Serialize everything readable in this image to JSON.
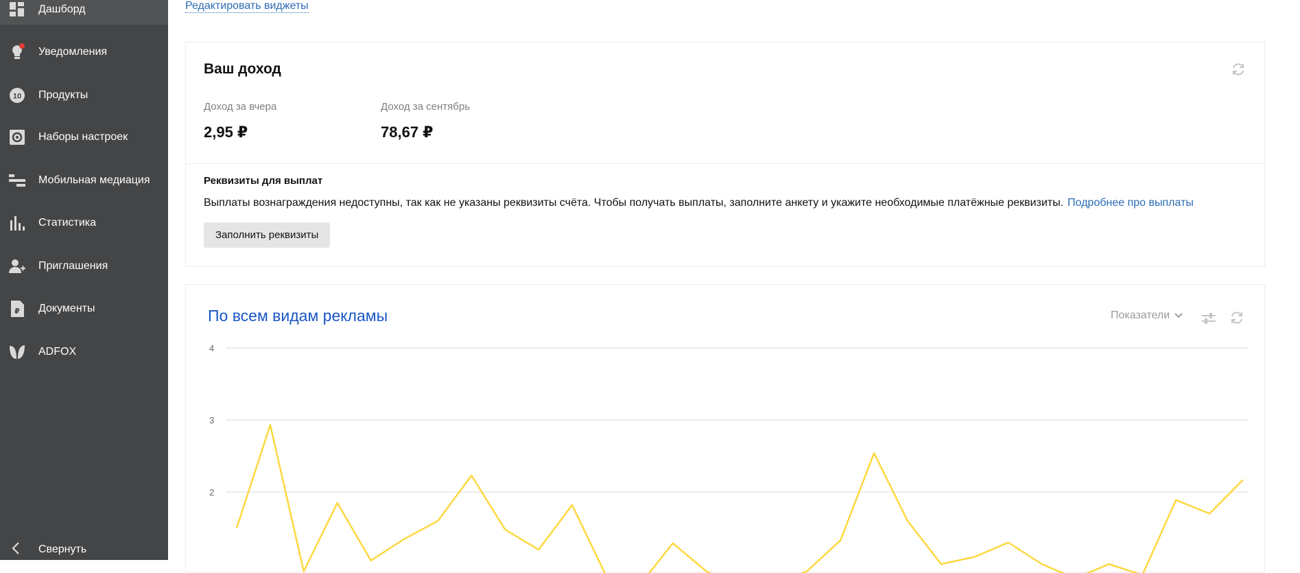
{
  "sidebar": {
    "items": [
      {
        "label": "Дашборд",
        "icon": "dashboard-icon"
      },
      {
        "label": "Уведомления",
        "icon": "bulb-icon"
      },
      {
        "label": "Продукты",
        "icon": "products-icon",
        "badge": "10"
      },
      {
        "label": "Наборы настроек",
        "icon": "settings-icon"
      },
      {
        "label": "Мобильная медиация",
        "icon": "mediation-icon"
      },
      {
        "label": "Статистика",
        "icon": "stats-icon"
      },
      {
        "label": "Приглашения",
        "icon": "invite-icon"
      },
      {
        "label": "Документы",
        "icon": "documents-icon"
      },
      {
        "label": "ADFOX",
        "icon": "adfox-icon"
      }
    ],
    "collapse_label": "Свернуть"
  },
  "main": {
    "edit_widgets": "Редактировать виджеты"
  },
  "income": {
    "title": "Ваш доход",
    "yesterday_label": "Доход за вчера",
    "yesterday_value": "2,95 ₽",
    "month_label": "Доход за сентябрь",
    "month_value": "78,67 ₽",
    "requisites_title": "Реквизиты для выплат",
    "requisites_text": "Выплаты вознаграждения недоступны, так как не указаны реквизиты счёта. Чтобы получать выплаты, заполните анкету и укажите необходимые платёжные реквизиты.",
    "requisites_link": "Подробнее про выплаты",
    "fill_button": "Заполнить реквизиты"
  },
  "chart_card": {
    "title": "По всем видам рекламы",
    "metrics_label": "Показатели"
  },
  "colors": {
    "sidebar_bg": "#444546",
    "link": "#2b6bb4",
    "chart_title": "#1a56c5",
    "line": "#fdd83f",
    "notification_dot": "#e53935"
  },
  "chart_data": {
    "type": "line",
    "y_ticks": [
      "4",
      "3",
      "2"
    ],
    "ylim": [
      1,
      4
    ],
    "series": [
      {
        "values": [
          1.5,
          2.93,
          0.9,
          1.85,
          1.05,
          1.35,
          1.6,
          2.23,
          1.48,
          1.2,
          1.82,
          0.85,
          0.7,
          1.29,
          0.9,
          0.65,
          0.7,
          0.9,
          1.33,
          2.54,
          1.6,
          1.0,
          1.1,
          1.3,
          1.0,
          0.8,
          1.0,
          0.85,
          1.89,
          1.7,
          2.17
        ]
      }
    ],
    "grid": true
  }
}
